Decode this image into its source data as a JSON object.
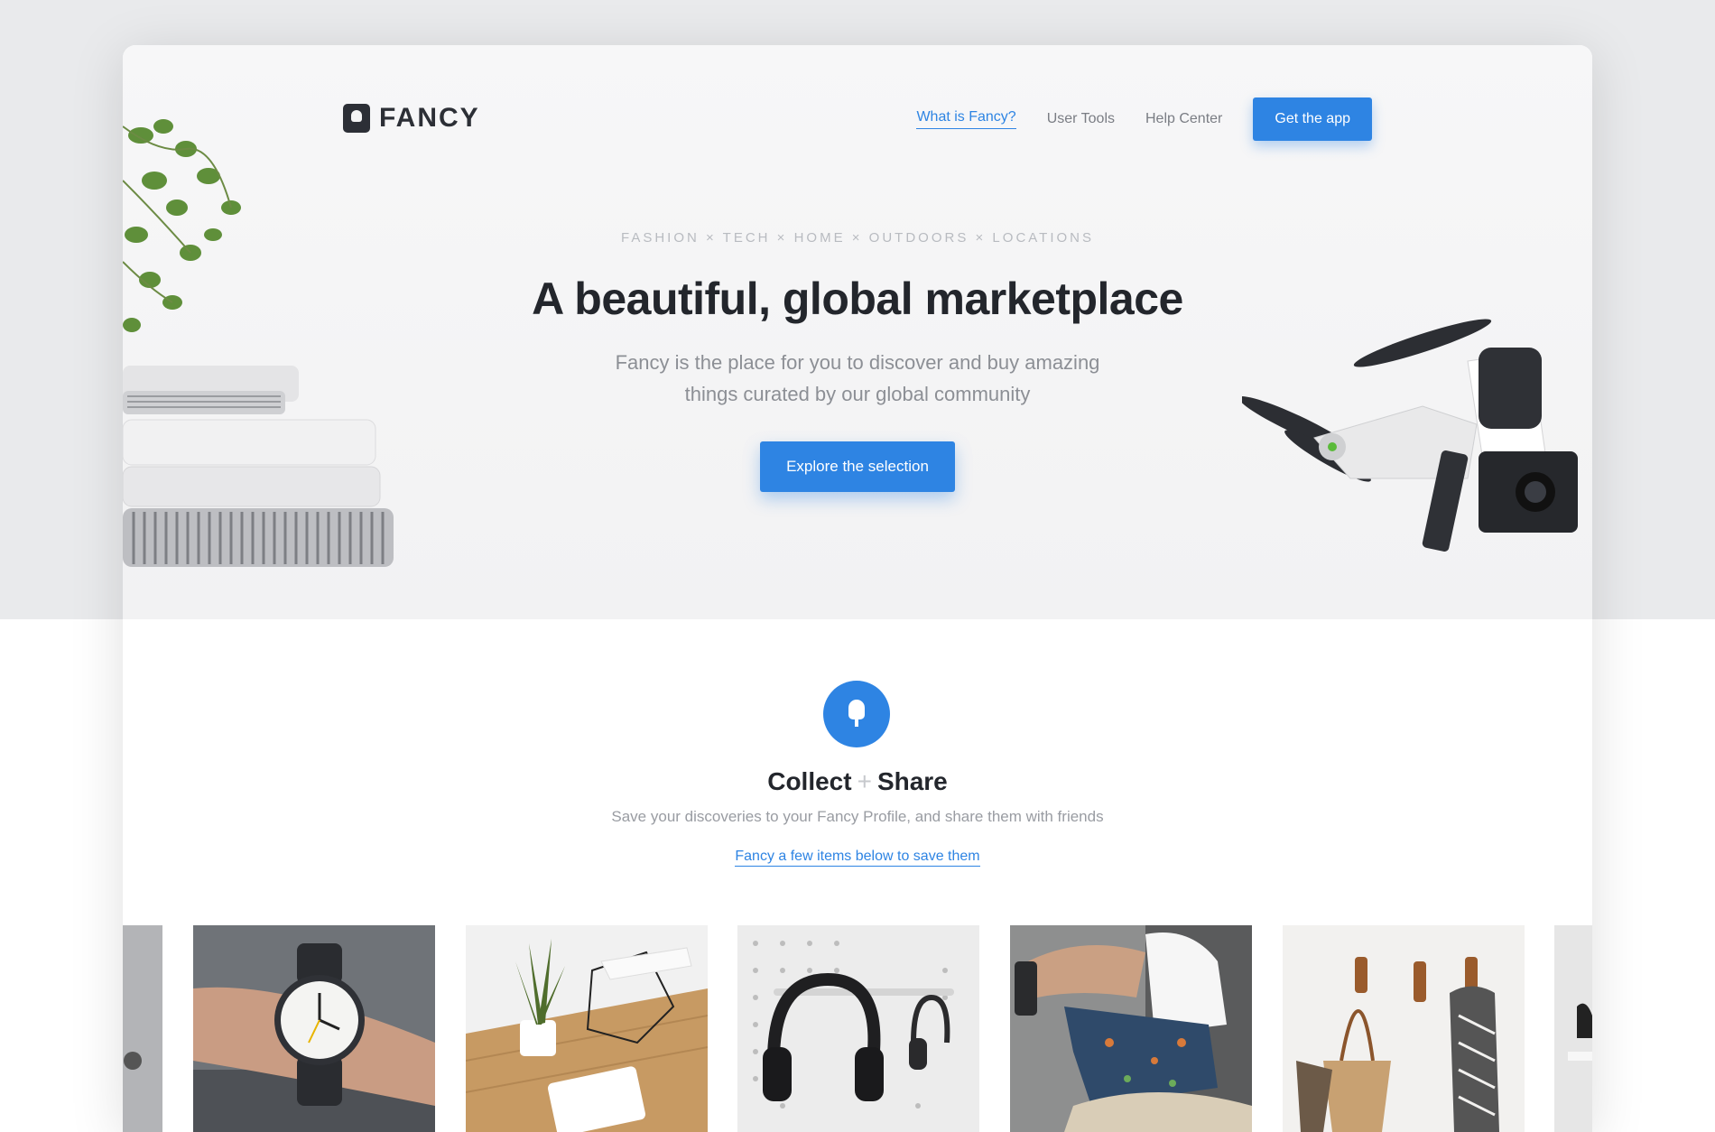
{
  "brand": {
    "name": "FANCY"
  },
  "nav": {
    "items": [
      {
        "label": "What is Fancy?",
        "active": true
      },
      {
        "label": "User Tools",
        "active": false
      },
      {
        "label": "Help Center",
        "active": false
      }
    ],
    "cta_label": "Get the app"
  },
  "hero": {
    "categories": "FASHION × TECH × HOME × OUTDOORS × LOCATIONS",
    "headline": "A beautiful, global marketplace",
    "subline": "Fancy is the place for you to discover and buy amazing things curated by our global community",
    "cta_label": "Explore the selection"
  },
  "collect": {
    "title_left": "Collect",
    "title_plus": "+",
    "title_right": "Share",
    "subtitle": "Save your discoveries to your Fancy Profile, and share them with friends",
    "link_label": "Fancy a few items below to save them"
  },
  "products": [
    {
      "name": "partial-item-left"
    },
    {
      "name": "wristwatch"
    },
    {
      "name": "plant-and-smart-scale"
    },
    {
      "name": "headphones-on-pegboard"
    },
    {
      "name": "floral-swim-shorts"
    },
    {
      "name": "tote-bag-and-scarves"
    },
    {
      "name": "partial-sneaker-right"
    }
  ],
  "colors": {
    "accent": "#2e84e3",
    "text_dark": "#23262c",
    "text_muted": "#8c8f95",
    "page_bg": "#e9eaec"
  }
}
